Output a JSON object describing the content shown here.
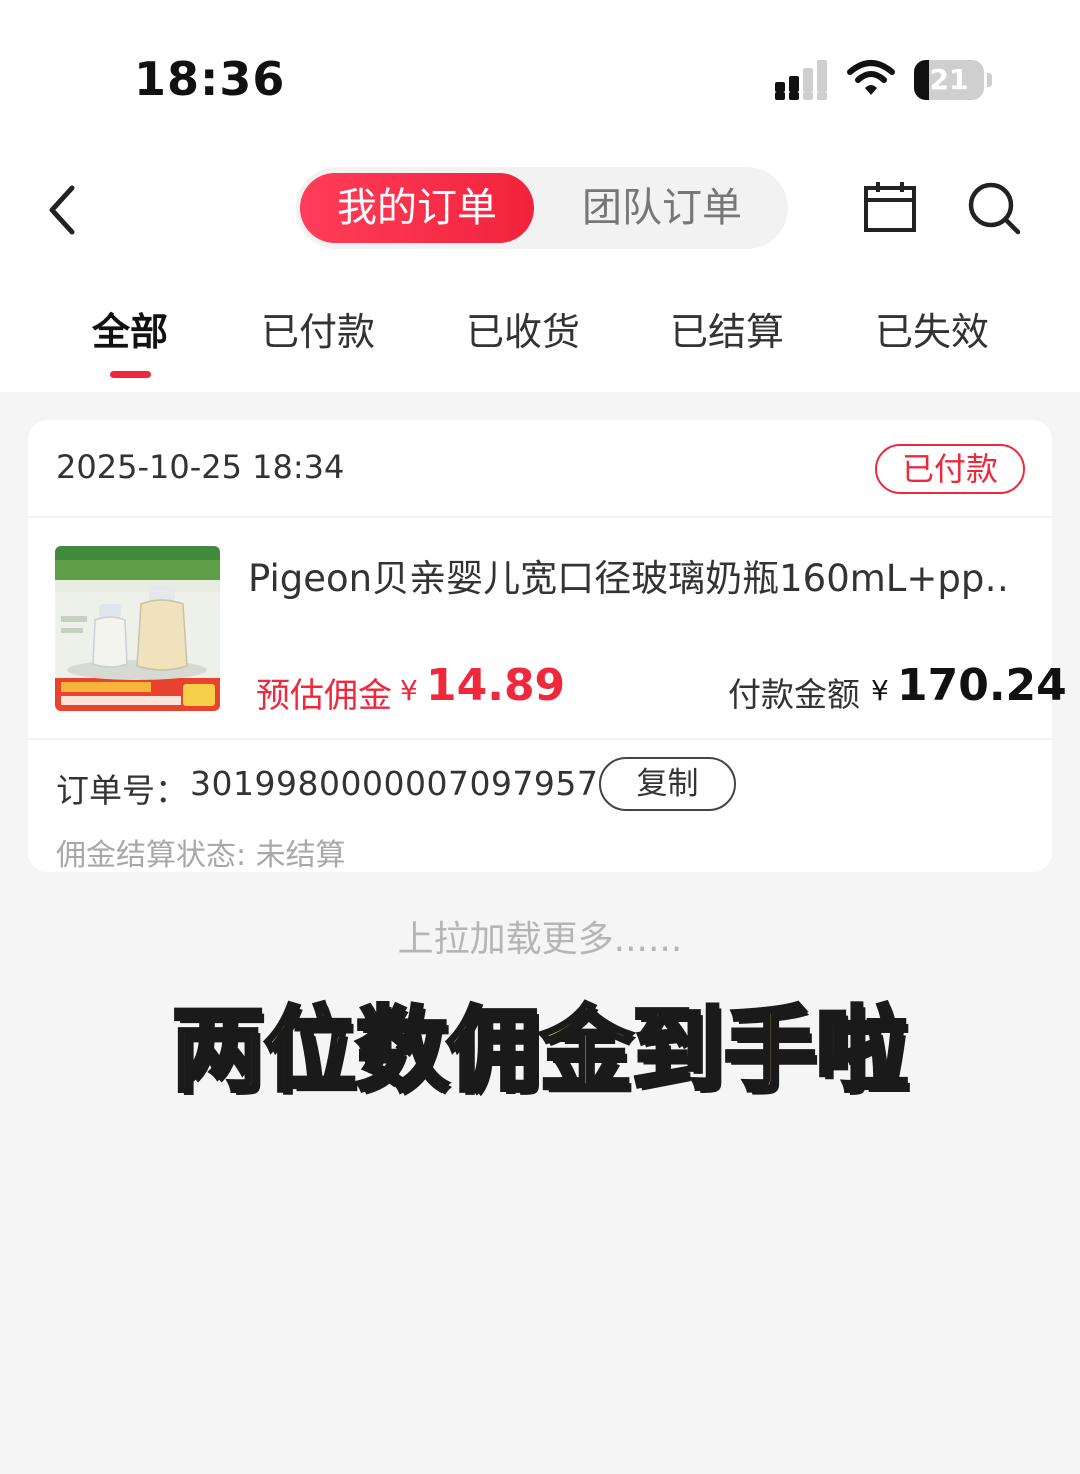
{
  "status_bar": {
    "time": "18:36",
    "battery": "21",
    "battery_level": 0.21
  },
  "nav": {
    "segments": [
      {
        "label": "我的订单",
        "active": true
      },
      {
        "label": "团队订单",
        "active": false
      }
    ],
    "icons": {
      "back": "chevron-left-icon",
      "calendar": "calendar-icon",
      "search": "search-icon"
    }
  },
  "tabs": [
    {
      "label": "全部",
      "active": true
    },
    {
      "label": "已付款",
      "active": false
    },
    {
      "label": "已收货",
      "active": false
    },
    {
      "label": "已结算",
      "active": false
    },
    {
      "label": "已失效",
      "active": false
    }
  ],
  "order": {
    "time": "2025-10-25 18:34",
    "status": "已付款",
    "product_title": "Pigeon贝亲婴儿宽口径玻璃奶瓶160mL+pp…",
    "commission_label": "预估佣金",
    "commission_currency": "¥",
    "commission_value": "14.89",
    "pay_label": "付款金额",
    "pay_currency": "¥",
    "pay_value": "170.24",
    "order_no_label": "订单号：",
    "order_no": "3019980000007097957",
    "copy_label": "复制",
    "settle_status": "佣金结算状态: 未结算"
  },
  "load_more": "上拉加载更多......",
  "overlay_caption": "两位数佣金到手啦",
  "colors": {
    "accent": "#f0283c",
    "caption": "#f8df6e"
  }
}
